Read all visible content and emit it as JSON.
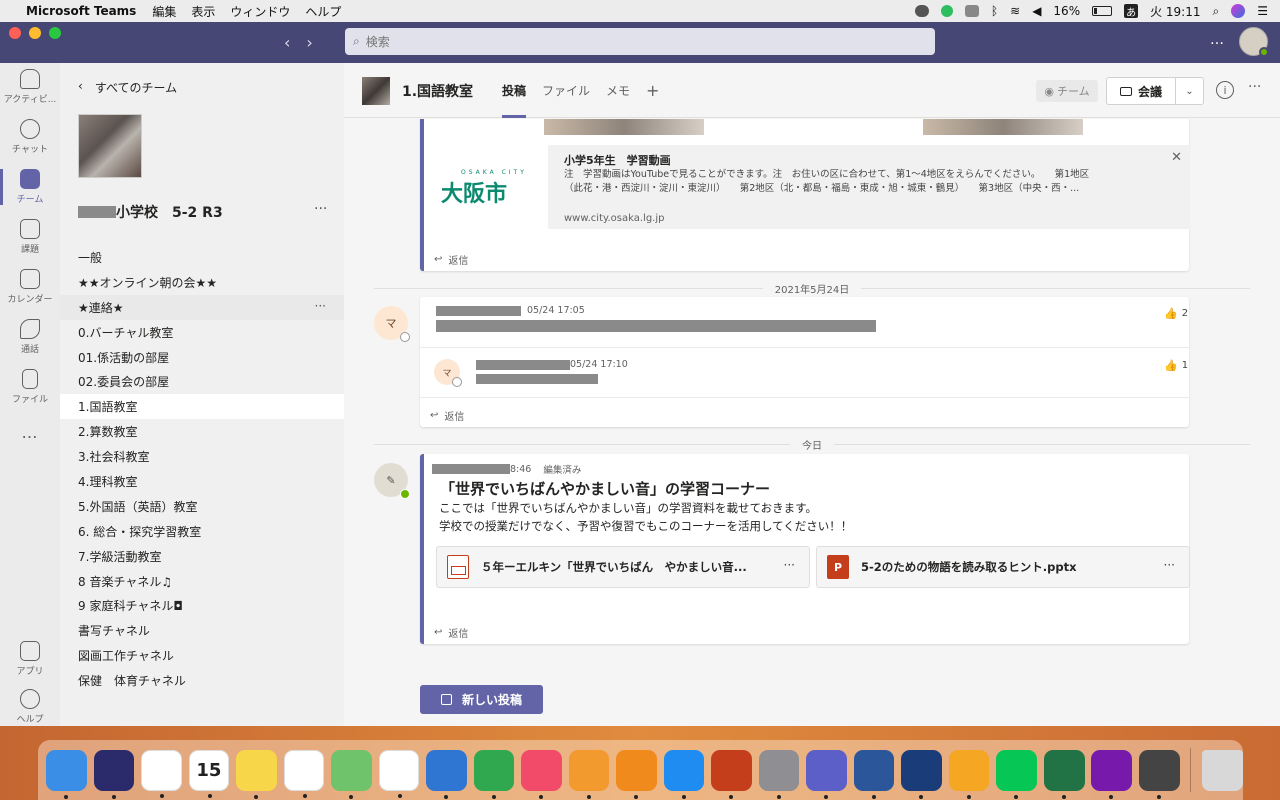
{
  "menubar": {
    "app": "Microsoft Teams",
    "items": [
      "編集",
      "表示",
      "ウィンドウ",
      "ヘルプ"
    ],
    "battery": "16%",
    "ime": "あ",
    "clock": "火 19:11"
  },
  "titlebar": {
    "search_placeholder": "検索",
    "more": "…"
  },
  "rail": {
    "items": [
      {
        "label": "アクティビ..."
      },
      {
        "label": "チャット"
      },
      {
        "label": "チーム"
      },
      {
        "label": "課題"
      },
      {
        "label": "カレンダー"
      },
      {
        "label": "通話"
      },
      {
        "label": "ファイル"
      }
    ],
    "more": "…",
    "bottom": [
      {
        "label": "アプリ"
      },
      {
        "label": "ヘルプ"
      }
    ]
  },
  "sidebar": {
    "back_label": "すべてのチーム",
    "team_name": "小学校　5-2 R3",
    "channels": [
      "一般",
      "★★オンライン朝の会★★",
      "★連絡★",
      "0.バーチャル教室",
      "01.係活動の部屋",
      "02.委員会の部屋",
      "1.国語教室",
      "2.算数教室",
      "3.社会科教室",
      "4.理科教室",
      "5.外国語（英語）教室",
      "6. 総合・探究学習教室",
      "7.学級活動教室",
      "8 音楽チャネル♫",
      "9 家庭科チャネル◘",
      "書写チャネル",
      "図画工作チャネル",
      "保健　体育チャネル"
    ]
  },
  "main": {
    "channel_title": "1.国語教室",
    "tabs": [
      "投稿",
      "ファイル",
      "メモ"
    ],
    "team_button": "チーム",
    "meet_button": "会議",
    "link_preview": {
      "title": "小学5年生　学習動画",
      "desc_line1": "注　学習動画はYouTubeで見ることができます。注　お住いの区に合わせて、第1〜4地区をえらんでください。　　第1地区",
      "desc_line2": "（此花・港・西淀川・淀川・東淀川）　　第2地区（北・都島・福島・東成・旭・城東・鶴見）　　第3地区（中央・西・...",
      "url": "www.city.osaka.lg.jp",
      "logo_top": "OSAKA CITY",
      "logo_text": "大阪市"
    },
    "reply_label": "返信",
    "date_sep1": "2021年5月24日",
    "date_sep2": "今日",
    "msg1": {
      "avatar": "マ",
      "time": "05/24 17:05",
      "likes": "2"
    },
    "msg1_reply": {
      "avatar": "マ",
      "time": "05/24 17:10",
      "likes": "1"
    },
    "post": {
      "time": "8:46",
      "edited": "編集済み",
      "title": "「世界でいちばんやかましい音」の学習コーナー",
      "line1": "ここでは「世界でいちばんやかましい音」の学習資料を載せておきます。",
      "line2": "学校での授業だけでなく、予習や復習でもこのコーナーを活用してください！！",
      "files": [
        {
          "name": "５年ーエルキン「世界でいちばん　やかましい音..."
        },
        {
          "name": "5-2のための物語を読み取るヒント.pptx"
        }
      ]
    },
    "new_post": "新しい投稿"
  },
  "dock": {
    "calendar_day": "15",
    "apps": [
      {
        "name": "finder",
        "color": "#3a8ee6"
      },
      {
        "name": "siri",
        "color": "#2b2b6b"
      },
      {
        "name": "chrome",
        "color": "#ffffff"
      },
      {
        "name": "calendar",
        "color": "#ffffff"
      },
      {
        "name": "notes",
        "color": "#f7d64a"
      },
      {
        "name": "reminders",
        "color": "#ffffff"
      },
      {
        "name": "maps",
        "color": "#6fc36b"
      },
      {
        "name": "photos",
        "color": "#ffffff"
      },
      {
        "name": "keynote",
        "color": "#2f76d2"
      },
      {
        "name": "numbers",
        "color": "#2fa84f"
      },
      {
        "name": "music",
        "color": "#f24b6a"
      },
      {
        "name": "pages",
        "color": "#f29a2e"
      },
      {
        "name": "books",
        "color": "#f08a1c"
      },
      {
        "name": "app-store",
        "color": "#1e8cf0"
      },
      {
        "name": "powerpoint",
        "color": "#c43e1c"
      },
      {
        "name": "system-preferences",
        "color": "#8e8e93"
      },
      {
        "name": "teams",
        "color": "#5b5fc7"
      },
      {
        "name": "word",
        "color": "#2b579a"
      },
      {
        "name": "quicktime",
        "color": "#1a3d7a"
      },
      {
        "name": "scratch",
        "color": "#f5a623"
      },
      {
        "name": "line",
        "color": "#06c755"
      },
      {
        "name": "excel",
        "color": "#217346"
      },
      {
        "name": "onenote",
        "color": "#7719aa"
      },
      {
        "name": "scansnap",
        "color": "#444444"
      }
    ],
    "trash": {
      "name": "trash",
      "color": "#d8d8d8"
    }
  }
}
